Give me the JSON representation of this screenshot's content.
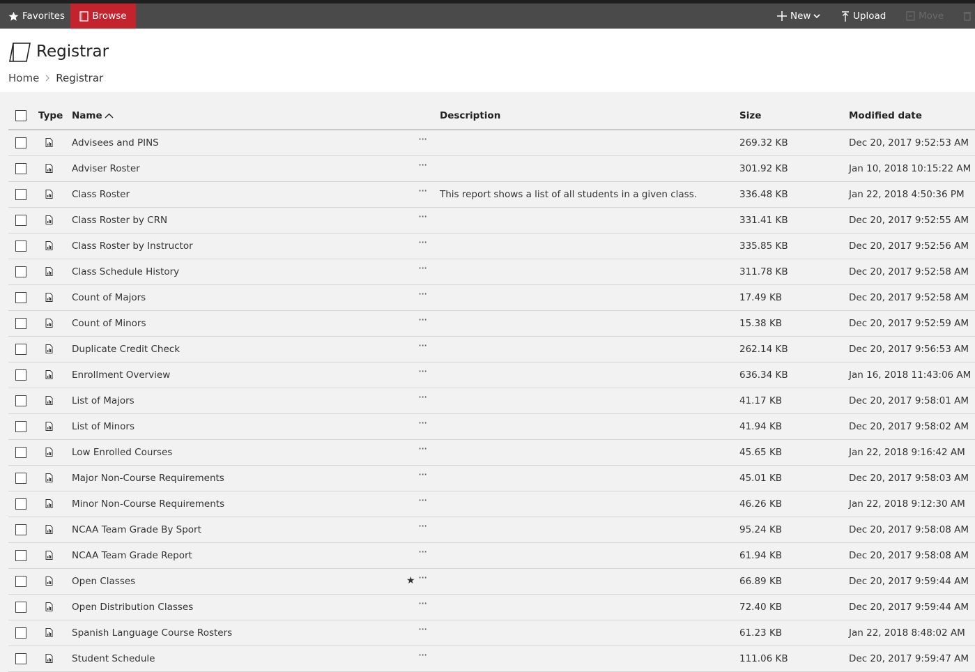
{
  "navbar": {
    "favorites_label": "Favorites",
    "browse_label": "Browse",
    "new_label": "New",
    "upload_label": "Upload",
    "move_label": "Move",
    "active_color": "#c4232d"
  },
  "header": {
    "title": "Registrar",
    "breadcrumb": {
      "home": "Home",
      "current": "Registrar"
    }
  },
  "table": {
    "columns": {
      "type": "Type",
      "name": "Name",
      "description": "Description",
      "size": "Size",
      "modified": "Modified date"
    },
    "sort": {
      "column": "Name",
      "direction": "ascending"
    },
    "rows": [
      {
        "name": "Advisees and PINS",
        "description": "",
        "size": "269.32 KB",
        "modified": "Dec 20, 2017 9:52:53 AM",
        "favorite": false
      },
      {
        "name": "Adviser Roster",
        "description": "",
        "size": "301.92 KB",
        "modified": "Jan 10, 2018 10:15:22 AM",
        "favorite": false
      },
      {
        "name": "Class Roster",
        "description": "This report shows a list of all students in a given class.",
        "size": "336.48 KB",
        "modified": "Jan 22, 2018 4:50:36 PM",
        "favorite": false
      },
      {
        "name": "Class Roster by CRN",
        "description": "",
        "size": "331.41 KB",
        "modified": "Dec 20, 2017 9:52:55 AM",
        "favorite": false
      },
      {
        "name": "Class Roster by Instructor",
        "description": "",
        "size": "335.85 KB",
        "modified": "Dec 20, 2017 9:52:56 AM",
        "favorite": false
      },
      {
        "name": "Class Schedule History",
        "description": "",
        "size": "311.78 KB",
        "modified": "Dec 20, 2017 9:52:58 AM",
        "favorite": false
      },
      {
        "name": "Count of Majors",
        "description": "",
        "size": "17.49 KB",
        "modified": "Dec 20, 2017 9:52:58 AM",
        "favorite": false
      },
      {
        "name": "Count of Minors",
        "description": "",
        "size": "15.38 KB",
        "modified": "Dec 20, 2017 9:52:59 AM",
        "favorite": false
      },
      {
        "name": "Duplicate Credit Check",
        "description": "",
        "size": "262.14 KB",
        "modified": "Dec 20, 2017 9:56:53 AM",
        "favorite": false
      },
      {
        "name": "Enrollment Overview",
        "description": "",
        "size": "636.34 KB",
        "modified": "Jan 16, 2018 11:43:06 AM",
        "favorite": false
      },
      {
        "name": "List of Majors",
        "description": "",
        "size": "41.17 KB",
        "modified": "Dec 20, 2017 9:58:01 AM",
        "favorite": false
      },
      {
        "name": "List of Minors",
        "description": "",
        "size": "41.94 KB",
        "modified": "Dec 20, 2017 9:58:02 AM",
        "favorite": false
      },
      {
        "name": "Low Enrolled Courses",
        "description": "",
        "size": "45.65 KB",
        "modified": "Jan 22, 2018 9:16:42 AM",
        "favorite": false
      },
      {
        "name": "Major Non-Course Requirements",
        "description": "",
        "size": "45.01 KB",
        "modified": "Dec 20, 2017 9:58:03 AM",
        "favorite": false
      },
      {
        "name": "Minor Non-Course Requirements",
        "description": "",
        "size": "46.26 KB",
        "modified": "Jan 22, 2018 9:12:30 AM",
        "favorite": false
      },
      {
        "name": "NCAA Team Grade By Sport",
        "description": "",
        "size": "95.24 KB",
        "modified": "Dec 20, 2017 9:58:08 AM",
        "favorite": false
      },
      {
        "name": "NCAA Team Grade Report",
        "description": "",
        "size": "61.94 KB",
        "modified": "Dec 20, 2017 9:58:08 AM",
        "favorite": false
      },
      {
        "name": "Open Classes",
        "description": "",
        "size": "66.89 KB",
        "modified": "Dec 20, 2017 9:59:44 AM",
        "favorite": true
      },
      {
        "name": "Open Distribution Classes",
        "description": "",
        "size": "72.40 KB",
        "modified": "Dec 20, 2017 9:59:44 AM",
        "favorite": false
      },
      {
        "name": "Spanish Language Course Rosters",
        "description": "",
        "size": "61.23 KB",
        "modified": "Jan 22, 2018 8:48:02 AM",
        "favorite": false
      },
      {
        "name": "Student Schedule",
        "description": "",
        "size": "111.06 KB",
        "modified": "Dec 20, 2017 9:59:47 AM",
        "favorite": false
      }
    ]
  }
}
